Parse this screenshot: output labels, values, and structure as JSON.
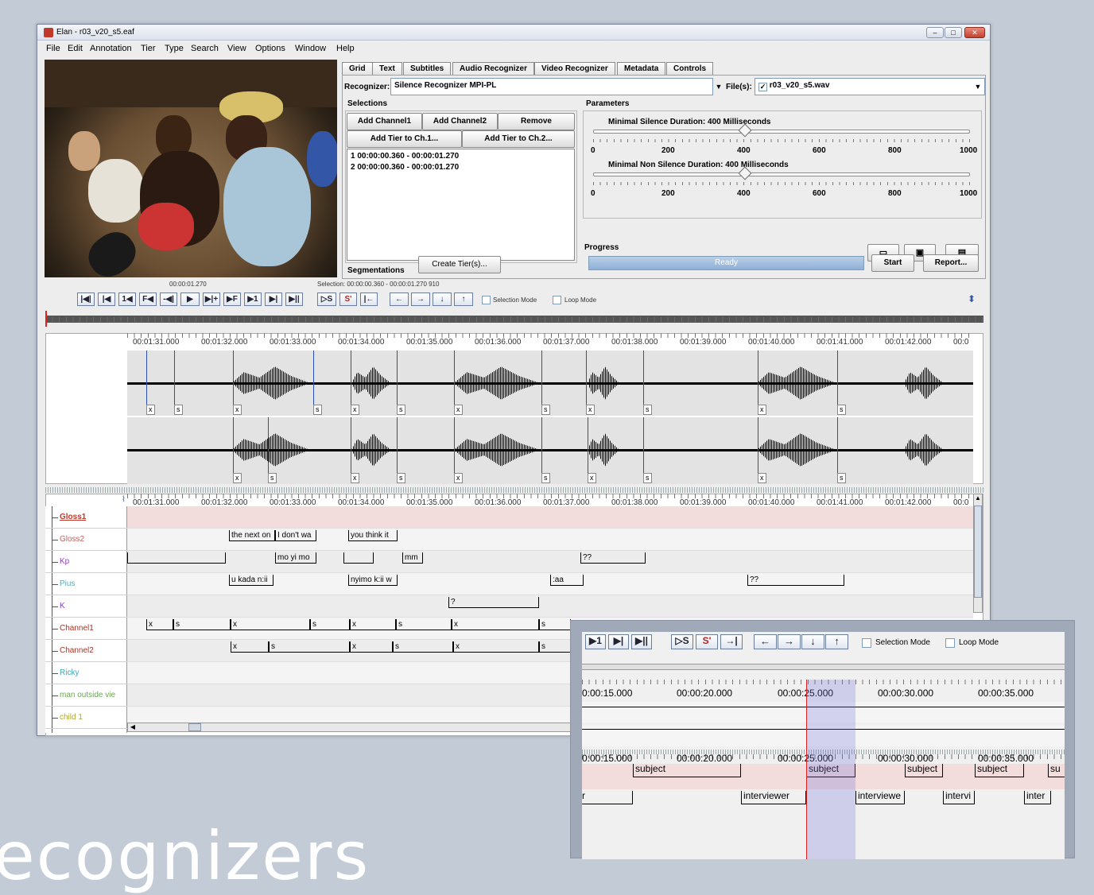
{
  "window": {
    "title": "Elan - r03_v20_s5.eaf"
  },
  "menu": [
    "File",
    "Edit",
    "Annotation",
    "Tier",
    "Type",
    "Search",
    "View",
    "Options",
    "Window",
    "Help"
  ],
  "tabs": [
    "Grid",
    "Text",
    "Subtitles",
    "Audio Recognizer",
    "Video Recognizer",
    "Metadata",
    "Controls"
  ],
  "active_tab": "Audio Recognizer",
  "recognizer": {
    "label": "Recognizer:",
    "value": "Silence Recognizer MPI-PL",
    "files_label": "File(s):",
    "file_value": "r03_v20_s5.wav"
  },
  "selections": {
    "title": "Selections",
    "buttons": [
      "Add Channel1",
      "Add Channel2",
      "Remove"
    ],
    "tier_buttons": [
      "Add Tier to Ch.1...",
      "Add Tier to Ch.2..."
    ],
    "items": [
      "1 00:00:00.360 - 00:00:01.270",
      "2 00:00:00.360 - 00:00:01.270"
    ]
  },
  "parameters": {
    "title": "Parameters",
    "slider1": {
      "label": "Minimal Silence Duration: 400 Milliseconds",
      "value": 400,
      "max": 1000
    },
    "slider2": {
      "label": "Minimal Non Silence Duration: 400 Milliseconds",
      "value": 400,
      "max": 1000
    },
    "ticks": [
      "0",
      "200",
      "400",
      "600",
      "800",
      "1000"
    ],
    "icon_buttons": [
      "folder-open-icon",
      "save-icon",
      "window-icon"
    ]
  },
  "segmentations": {
    "title": "Segmentations",
    "button": "Create Tier(s)..."
  },
  "progress": {
    "title": "Progress",
    "status": "Ready",
    "start": "Start",
    "report": "Report..."
  },
  "player": {
    "time": "00:00:01.270",
    "selection": "Selection: 00:00:00.360 - 00:00:01.270  910",
    "transport": [
      "|◀|",
      "|◀",
      "1◀",
      "F◀",
      "-◀|",
      "▶",
      "▶|+",
      "▶F",
      "▶1",
      "▶|",
      "▶||"
    ],
    "sel_buttons": [
      "▷S",
      "S'",
      "|←"
    ],
    "arrows": [
      "←",
      "→",
      "↓",
      "↑"
    ],
    "selection_mode": "Selection Mode",
    "loop_mode": "Loop Mode"
  },
  "timeline_ticks": [
    "00:01:31.000",
    "00:01:32.000",
    "00:01:33.000",
    "00:01:34.000",
    "00:01:35.000",
    "00:01:36.000",
    "00:01:37.000",
    "00:01:38.000",
    "00:01:39.000",
    "00:01:40.000",
    "00:01:41.000",
    "00:01:42.000",
    "00:0"
  ],
  "channel1_marks": [
    "x",
    "s",
    "x",
    "s",
    "x",
    "s",
    "x",
    "s",
    "x",
    "s",
    "x",
    "s"
  ],
  "channel2_marks": [
    "x",
    "s",
    "x",
    "s",
    "x",
    "s",
    "x",
    "s",
    "x",
    "s"
  ],
  "tiers": [
    {
      "name": "Gloss1",
      "color": "#c0392b"
    },
    {
      "name": "Gloss2",
      "color": "#c0625e"
    },
    {
      "name": "Kp",
      "color": "#8e44ad"
    },
    {
      "name": "Pius",
      "color": "#5fa8b5"
    },
    {
      "name": "K",
      "color": "#7a3fbf"
    },
    {
      "name": "Channel1",
      "color": "#a93226"
    },
    {
      "name": "Channel2",
      "color": "#a93226"
    },
    {
      "name": "Ricky",
      "color": "#3aa8b8"
    },
    {
      "name": "man outside vie",
      "color": "#6aa84f"
    },
    {
      "name": "child 1",
      "color": "#a8a832"
    }
  ],
  "annotations": {
    "gloss2": [
      "the next on",
      "I don't wa",
      "you think it"
    ],
    "kp": [
      "mo yi mo",
      "mm",
      "??"
    ],
    "pius": [
      "u kada n:ii",
      "nyimo k:ii w",
      ":aa",
      "??"
    ],
    "k": [
      "?"
    ],
    "ch1": [
      "x",
      "s",
      "x",
      "s",
      "x",
      "s",
      "x",
      "s"
    ],
    "ch2": [
      "x",
      "s",
      "x",
      "s",
      "x",
      "s"
    ]
  },
  "inset": {
    "transport": [
      "▶1",
      "▶|",
      "▶||"
    ],
    "sel_buttons": [
      "▷S",
      "S'",
      "→|"
    ],
    "arrows": [
      "←",
      "→",
      "↓",
      "↑"
    ],
    "selection_mode": "Selection Mode",
    "loop_mode": "Loop Mode",
    "ticks": [
      "0:00:15.000",
      "00:00:20.000",
      "00:00:25.000",
      "00:00:30.000",
      "00:00:35.000"
    ],
    "row1": [
      "subject",
      "subject",
      "subject",
      "subject",
      "su"
    ],
    "row2": [
      "r",
      "interviewer",
      "interviewe",
      "intervi",
      "inter"
    ]
  },
  "background_text": "ecognizers"
}
